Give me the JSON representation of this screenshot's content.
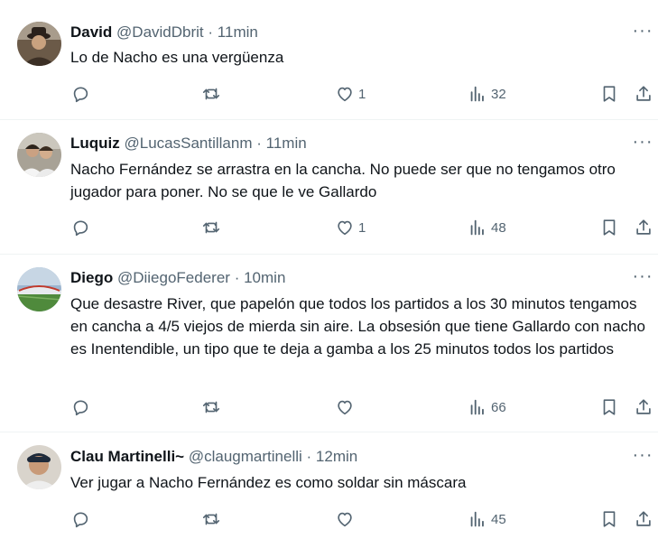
{
  "replies": [
    {
      "name": "David",
      "handle": "@DavidDbrit",
      "separator": "·",
      "time": "11min",
      "text": "Lo de Nacho es una vergüenza",
      "reply_count": "",
      "retweet_count": "",
      "like_count": "1",
      "view_count": "32"
    },
    {
      "name": "Luquiz",
      "handle": "@LucasSantillanm",
      "separator": "·",
      "time": "11min",
      "text": "Nacho Fernández se arrastra en la cancha. No puede ser que no tengamos otro jugador para poner. No se que le ve Gallardo",
      "reply_count": "",
      "retweet_count": "",
      "like_count": "1",
      "view_count": "48"
    },
    {
      "name": "Diego",
      "handle": "@DiiegoFederer",
      "separator": "·",
      "time": "10min",
      "text": "Que desastre River, que papelón que todos los partidos a los 30 minutos tengamos en cancha a 4/5 viejos de mierda sin aire. La obsesión que tiene Gallardo con nacho es Inentendible, un tipo que te deja a gamba a los 25 minutos todos los partidos",
      "reply_count": "",
      "retweet_count": "",
      "like_count": "",
      "view_count": "66"
    },
    {
      "name": "Clau Martinelli~",
      "handle": "@claugmartinelli",
      "separator": "·",
      "time": "12min",
      "text": "Ver jugar a Nacho Fernández es como soldar sin máscara",
      "reply_count": "",
      "retweet_count": "",
      "like_count": "",
      "view_count": "45"
    }
  ],
  "more_label": "···",
  "icons": {
    "reply": "reply-icon",
    "retweet": "retweet-icon",
    "like": "like-icon",
    "views": "views-icon",
    "bookmark": "bookmark-icon",
    "share": "share-icon",
    "more": "more-icon"
  },
  "colors": {
    "text": "#0f1419",
    "secondary": "#536471",
    "divider": "#eff3f4"
  }
}
